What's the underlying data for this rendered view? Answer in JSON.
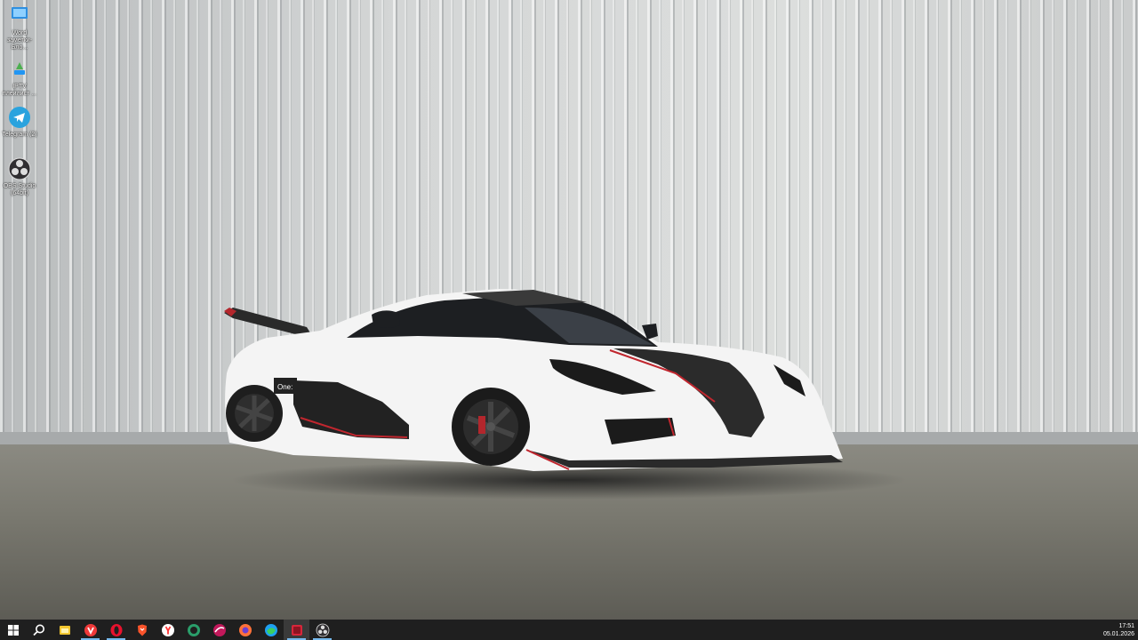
{
  "desktop": {
    "icons": [
      {
        "label": "Word\nзаметки-Бло...",
        "icon": "computer-folder-icon"
      },
      {
        "label": "IPTV\nплейлист ...",
        "icon": "iptv-player-icon"
      },
      {
        "label": "Telegram (2)",
        "icon": "telegram-icon"
      },
      {
        "label": "OBS Studio\n(64bit)",
        "icon": "obs-studio-icon"
      }
    ]
  },
  "taskbar": {
    "start_icon": "windows-start-icon",
    "search_icon": "search-icon",
    "pinned": [
      {
        "name": "file-explorer",
        "icon": "folder-icon",
        "color": "#f2c62f"
      },
      {
        "name": "vivaldi",
        "icon": "vivaldi-icon",
        "color": "#ef3939"
      },
      {
        "name": "opera",
        "icon": "opera-icon",
        "color": "#e8112d"
      },
      {
        "name": "brave",
        "icon": "brave-icon",
        "color": "#fb542b"
      },
      {
        "name": "yandex-browser",
        "icon": "yandex-browser-icon",
        "color": "#ff3333"
      },
      {
        "name": "comodo-dragon",
        "icon": "dragon-browser-icon",
        "color": "#2a9d6a"
      },
      {
        "name": "slimjet",
        "icon": "slimjet-icon",
        "color": "#c2185b"
      },
      {
        "name": "firefox",
        "icon": "firefox-icon",
        "color": "#ff7139"
      },
      {
        "name": "edge",
        "icon": "edge-icon",
        "color": "#1ea1f2"
      },
      {
        "name": "active-app",
        "icon": "red-app-icon",
        "color": "#d6263a"
      },
      {
        "name": "obs-studio",
        "icon": "obs-studio-icon",
        "color": "#302e31"
      }
    ],
    "clock": {
      "time": "17:51",
      "date": "05.01.2026"
    }
  },
  "colors": {
    "taskbar_bg": "#1f1f1f",
    "running_indicator": "#76b9ed"
  }
}
